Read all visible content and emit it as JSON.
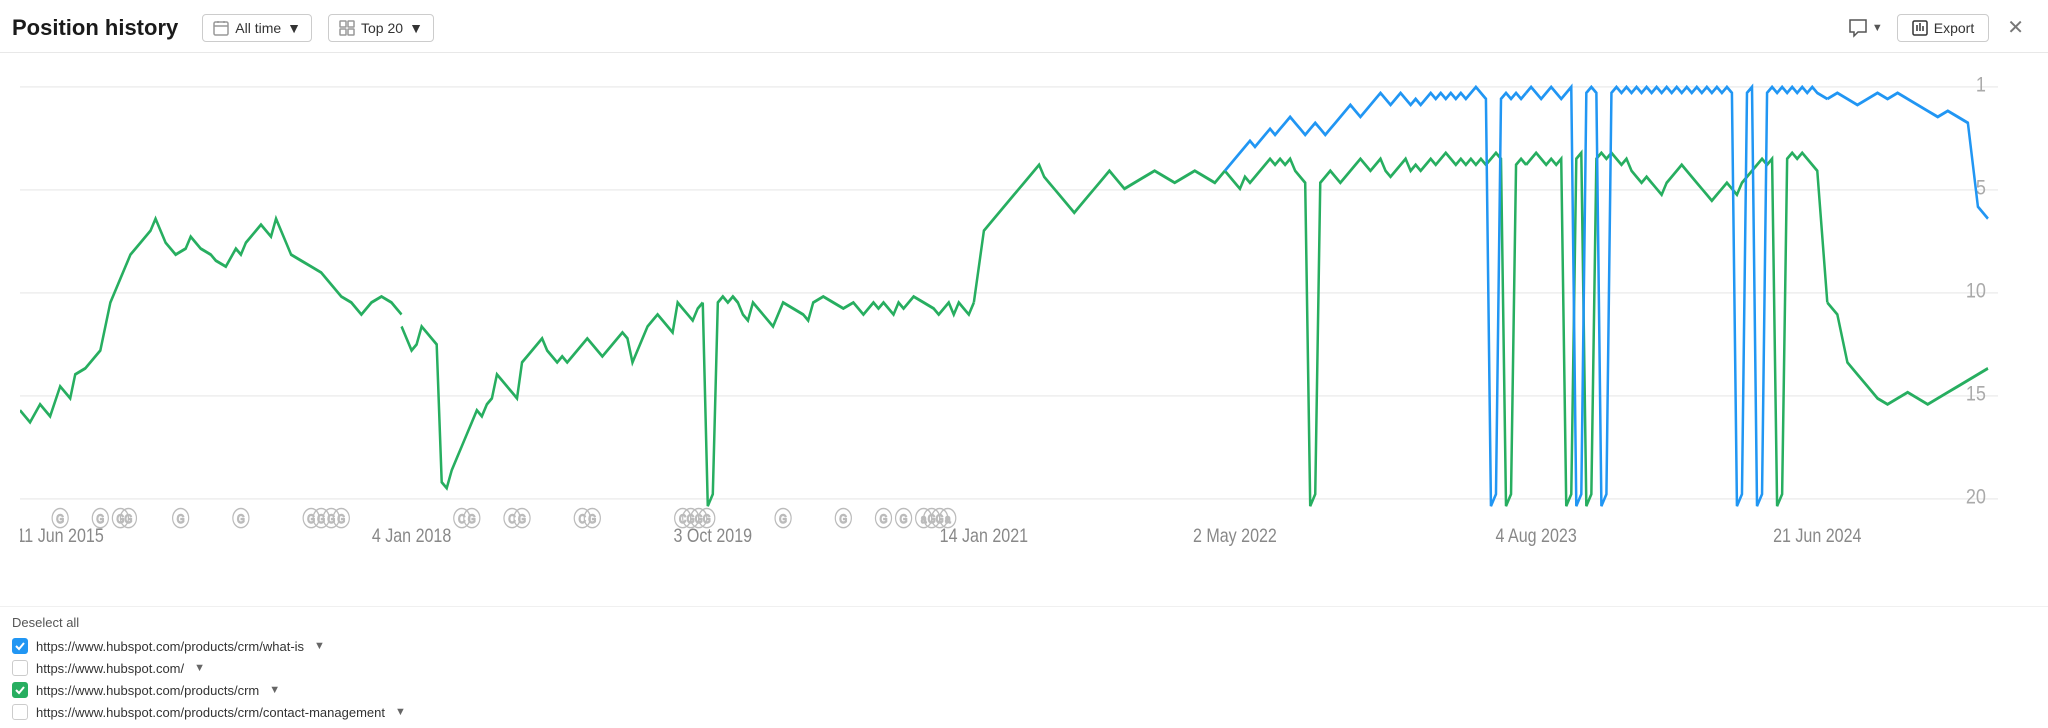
{
  "header": {
    "title": "Position history",
    "filter_time_label": "All time",
    "filter_top_label": "Top 20",
    "export_label": "Export"
  },
  "chart": {
    "y_labels": [
      "1",
      "5",
      "10",
      "15",
      "20"
    ],
    "x_labels": [
      "11 Jun 2015",
      "4 Jan 2018",
      "3 Oct 2019",
      "14 Jan 2021",
      "2 May 2022",
      "4 Aug 2023",
      "21 Jun 2024"
    ]
  },
  "legend": {
    "deselect_label": "Deselect all",
    "items": [
      {
        "url": "https://www.hubspot.com/products/crm/what-is",
        "checked": true,
        "type": "blue"
      },
      {
        "url": "https://www.hubspot.com/",
        "checked": false,
        "type": "none"
      },
      {
        "url": "https://www.hubspot.com/products/crm",
        "checked": true,
        "type": "green"
      },
      {
        "url": "https://www.hubspot.com/products/crm/contact-management",
        "checked": false,
        "type": "none"
      }
    ]
  }
}
